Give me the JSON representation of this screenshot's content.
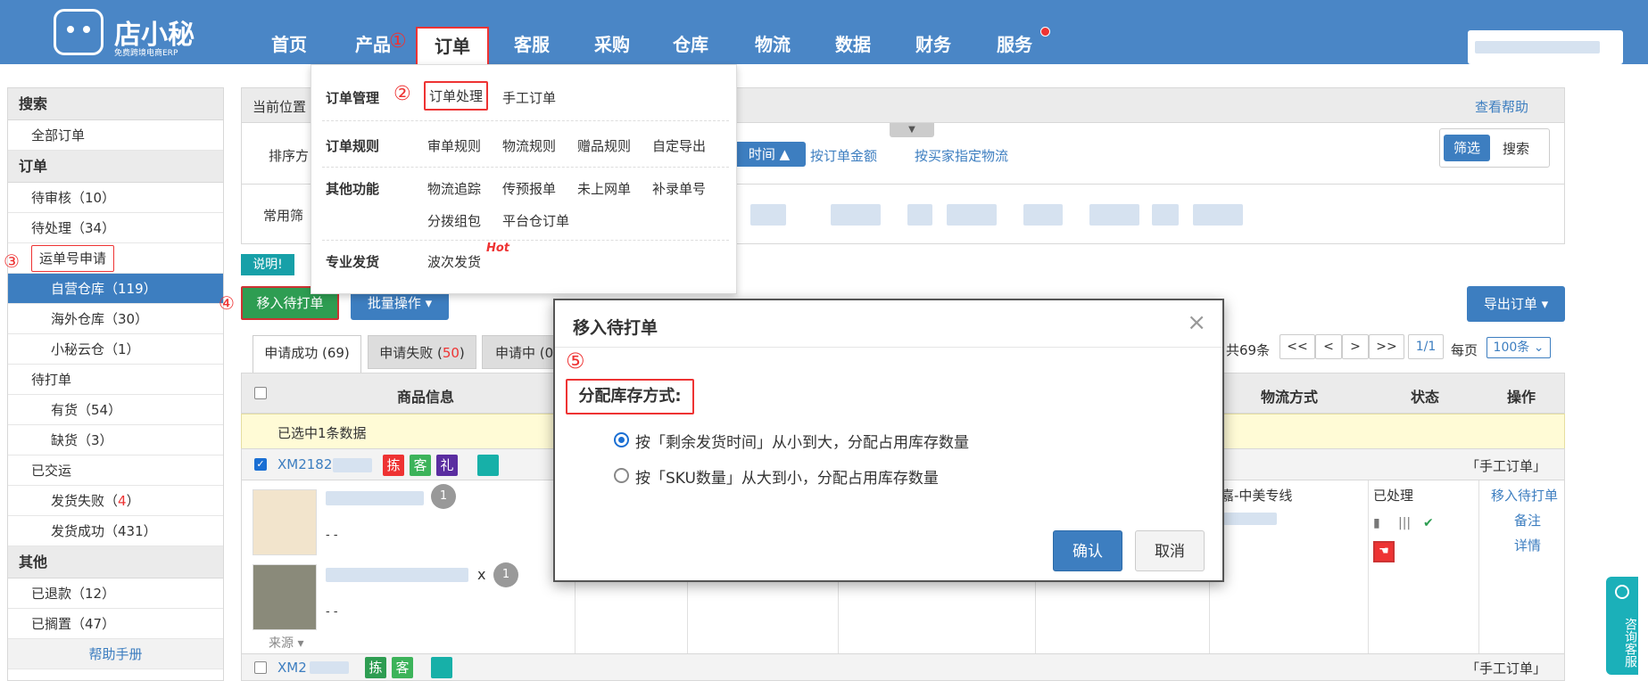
{
  "brand": {
    "name": "店小秘",
    "tagline": "免费跨境电商ERP"
  },
  "nav": {
    "items": [
      "首页",
      "产品",
      "订单",
      "客服",
      "采购",
      "仓库",
      "物流",
      "数据",
      "财务",
      "服务"
    ],
    "active": "订单"
  },
  "annotations": [
    "①",
    "②",
    "③",
    "④",
    "⑤"
  ],
  "sidebar": {
    "search_header": "搜索",
    "all_orders": "全部订单",
    "order_header": "订单",
    "pending_review": "待审核",
    "pending_review_count": "（10）",
    "pending_process": "待处理",
    "pending_process_count": "（34）",
    "waybill_apply": "运单号申请",
    "self_warehouse": "自营仓库",
    "self_warehouse_count": "（119）",
    "overseas_warehouse": "海外仓库",
    "overseas_warehouse_count": "（30）",
    "xiaomi_cloud": "小秘云仓",
    "xiaomi_cloud_count": "（1）",
    "pending_print": "待打单",
    "in_stock": "有货",
    "in_stock_count": "（54）",
    "out_of_stock": "缺货",
    "out_of_stock_count": "（3）",
    "shipped": "已交运",
    "ship_failed": "发货失败",
    "ship_failed_count_open": "（",
    "ship_failed_count": "4",
    "ship_failed_count_close": "）",
    "ship_success": "发货成功",
    "ship_success_count": "（431）",
    "other_header": "其他",
    "refunded": "已退款",
    "refunded_count": "（12）",
    "on_hold": "已搁置",
    "on_hold_count": "（47）",
    "help": "帮助手册"
  },
  "main": {
    "location_label": "当前位置",
    "help_link": "查看帮助",
    "sort_label": "排序方",
    "sort_time": "时间",
    "sort_amount": "按订单金额",
    "sort_logistics": "按买家指定物流",
    "filter_btn": "筛选",
    "search_btn": "搜索",
    "common_filter": "常用筛",
    "note": "说明!",
    "move_btn": "移入待打单",
    "batch_btn": "批量操作 ▾",
    "export_btn": "导出订单 ▾",
    "tabs": {
      "success": "申请成功 (69)",
      "fail_label": "申请失败 (",
      "fail_count": "50",
      "fail_close": ")",
      "pending": "申请中 (0"
    },
    "pagination": {
      "total": "共69条",
      "first": "<<",
      "prev": "<",
      "next": ">",
      "last": ">>",
      "page": "1/1",
      "per_page_label": "每页",
      "per_page": "100条"
    },
    "columns": {
      "product": "商品信息",
      "logistics": "物流方式",
      "status": "状态",
      "action": "操作"
    },
    "selected_notice": "已选中1条数据",
    "order1": {
      "id": "XM2182",
      "tags": [
        "拣",
        "客",
        "礼"
      ],
      "type": "「手工订单」",
      "qty": "1",
      "qty2": "1",
      "x": "x",
      "dash": "- -",
      "dash2": "- -",
      "source": "来源",
      "logistics": "泰嘉-中美专线",
      "status": "已处理",
      "actions": [
        "移入待打单",
        "备注",
        "详情"
      ]
    },
    "order2": {
      "id": "XM2",
      "tags": [
        "拣",
        "客"
      ],
      "type": "「手工订单」"
    }
  },
  "dropdown": {
    "order_mgmt": "订单管理",
    "order_process": "订单处理",
    "manual_order": "手工订单",
    "order_rules": "订单规则",
    "audit_rules": "审单规则",
    "logistics_rules": "物流规则",
    "gift_rules": "赠品规则",
    "custom_export": "自定导出",
    "other_funcs": "其他功能",
    "logistics_track": "物流追踪",
    "pre_report": "传预报单",
    "offline_order": "未上网单",
    "supplement_no": "补录单号",
    "split_pack": "分拨组包",
    "platform_order": "平台仓订单",
    "pro_ship": "专业发货",
    "batch_ship": "波次发货",
    "hot": "Hot"
  },
  "modal": {
    "title": "移入待打单",
    "close": "×",
    "section": "分配库存方式:",
    "option1": "按「剩余发货时间」从小到大，分配占用库存数量",
    "option2": "按「SKU数量」从大到小，分配占用库存数量",
    "confirm": "确认",
    "cancel": "取消"
  },
  "consult": "咨询客服",
  "colors": {
    "nav": "#4a86c6",
    "primary": "#3d7ec0",
    "green": "#2e9d52",
    "red": "#e33333",
    "teal": "#1bb0b9"
  }
}
